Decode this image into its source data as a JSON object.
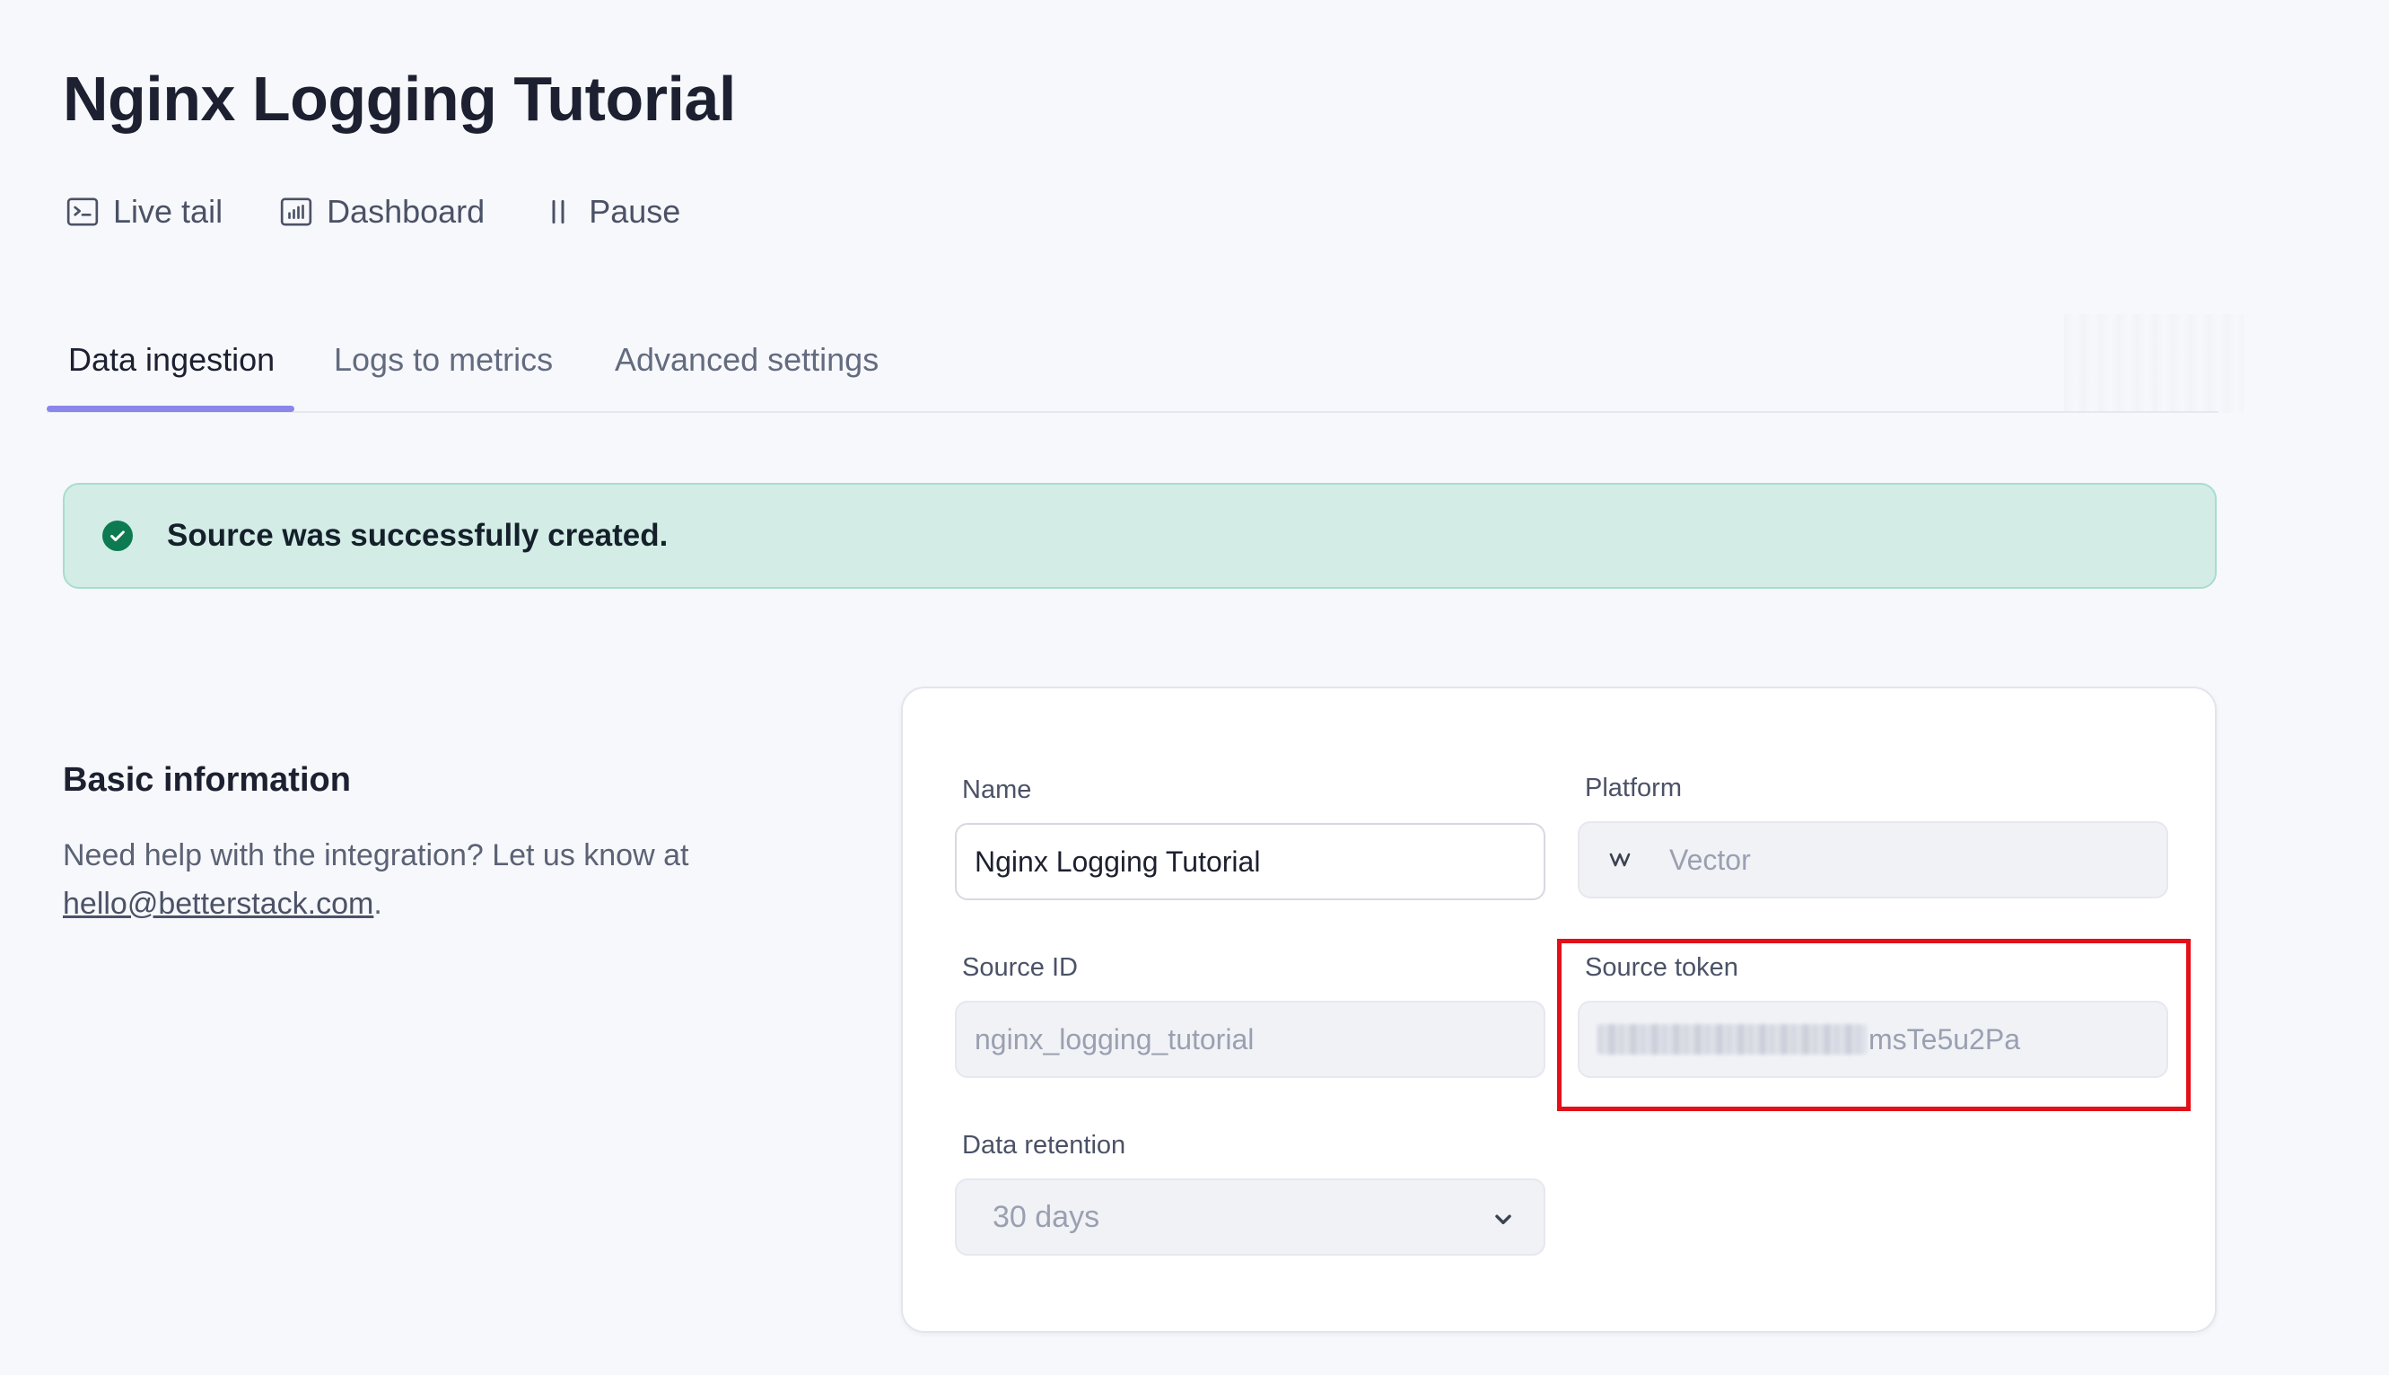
{
  "page": {
    "title": "Nginx Logging Tutorial"
  },
  "actions": [
    {
      "label": "Live tail",
      "icon": "terminal-icon"
    },
    {
      "label": "Dashboard",
      "icon": "bar-chart-icon"
    },
    {
      "label": "Pause",
      "icon": "pause-icon"
    }
  ],
  "tabs": [
    {
      "label": "Data ingestion",
      "active": true
    },
    {
      "label": "Logs to metrics",
      "active": false
    },
    {
      "label": "Advanced settings",
      "active": false
    }
  ],
  "alert": {
    "message": "Source was successfully created.",
    "icon": "check-circle-icon",
    "color": "#0e7a52"
  },
  "basic_info": {
    "title": "Basic information",
    "help_prefix": "Need help with the integration? Let us know at ",
    "email": "hello@betterstack.com",
    "help_suffix": "."
  },
  "form": {
    "name_label": "Name",
    "name_value": "Nginx Logging Tutorial",
    "platform_label": "Platform",
    "platform_value": "Vector",
    "source_id_label": "Source ID",
    "source_id_value": "nginx_logging_tutorial",
    "token_label": "Source token",
    "token_visible_suffix": "msTe5u2Pa",
    "retention_label": "Data retention",
    "retention_value": "30 days"
  },
  "colors": {
    "accent": "#8b86ea",
    "highlight": "#e3101a",
    "success_bg": "#d3ede6"
  }
}
